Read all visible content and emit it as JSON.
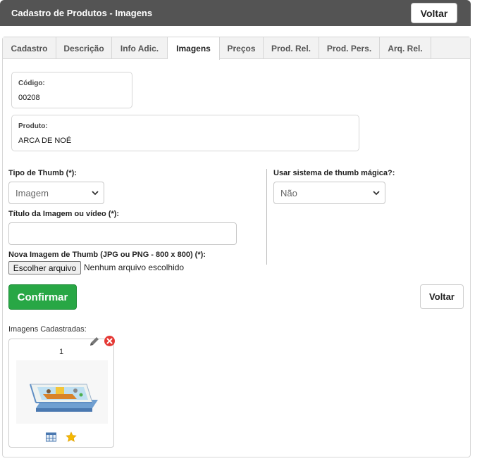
{
  "header": {
    "title": "Cadastro de Produtos - Imagens",
    "back_label": "Voltar"
  },
  "tabs": [
    {
      "label": "Cadastro",
      "active": false
    },
    {
      "label": "Descrição",
      "active": false
    },
    {
      "label": "Info Adic.",
      "active": false
    },
    {
      "label": "Imagens",
      "active": true
    },
    {
      "label": "Preços",
      "active": false
    },
    {
      "label": "Prod. Rel.",
      "active": false
    },
    {
      "label": "Prod. Pers.",
      "active": false
    },
    {
      "label": "Arq. Rel.",
      "active": false
    }
  ],
  "codigo": {
    "label": "Código:",
    "value": "00208"
  },
  "produto": {
    "label": "Produto:",
    "value": "ARCA DE NOÉ"
  },
  "form": {
    "thumb_type_label": "Tipo de Thumb (*):",
    "thumb_type_value": "Imagem",
    "magic_label": "Usar sistema de thumb mágica?:",
    "magic_value": "Não",
    "title_label": "Título da Imagem ou vídeo (*):",
    "title_value": "",
    "new_image_label": "Nova Imagem de Thumb (JPG ou PNG - 800 x 800) (*):",
    "file_button": "Escolher arquivo",
    "file_status": "Nenhum arquivo escolhido"
  },
  "actions": {
    "confirm_label": "Confirmar",
    "back_label": "Voltar"
  },
  "images": {
    "section_title": "Imagens Cadastradas:",
    "items": [
      {
        "index": "1"
      }
    ]
  },
  "colors": {
    "header_bg": "#545454",
    "confirm_bg": "#28a745",
    "delete_red": "#e53935",
    "star_yellow": "#f5b800"
  }
}
